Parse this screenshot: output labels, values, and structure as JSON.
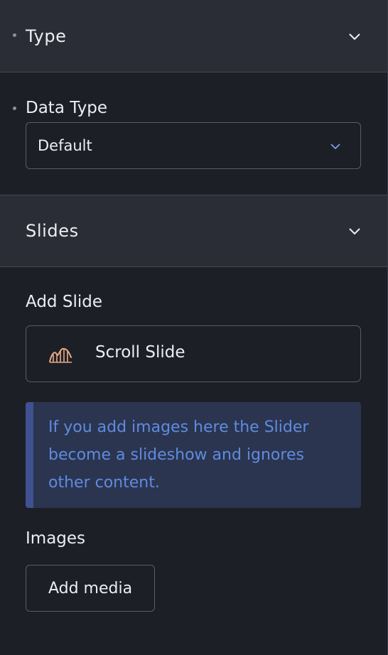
{
  "sections": {
    "type": {
      "title": "Type"
    },
    "slides": {
      "title": "Slides"
    }
  },
  "data_type": {
    "label": "Data Type",
    "selected": "Default"
  },
  "add_slide": {
    "label": "Add Slide",
    "button_label": "Scroll Slide",
    "icon": "roller-coaster-icon"
  },
  "notice": {
    "text": "If you add images here the Slider become a slideshow and ignores other content.",
    "color": "#5f8be0",
    "background": "#2b3550",
    "accent": "#3f5190"
  },
  "images": {
    "label": "Images",
    "button_label": "Add media"
  }
}
